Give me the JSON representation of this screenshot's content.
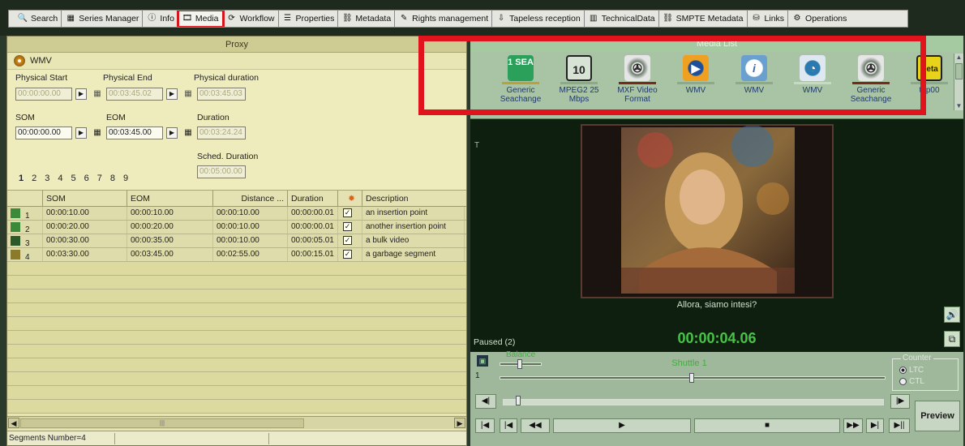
{
  "tabs": [
    {
      "label": "Search",
      "icon": "search-icon",
      "active": false
    },
    {
      "label": "Series Manager",
      "icon": "series-icon",
      "active": false
    },
    {
      "label": "Info",
      "icon": "info-icon",
      "active": false
    },
    {
      "label": "Media",
      "icon": "media-icon",
      "active": true
    },
    {
      "label": "Workflow",
      "icon": "workflow-icon",
      "active": false
    },
    {
      "label": "Properties",
      "icon": "properties-icon",
      "active": false
    },
    {
      "label": "Metadata",
      "icon": "metadata-icon",
      "active": false
    },
    {
      "label": "Rights management",
      "icon": "rights-icon",
      "active": false
    },
    {
      "label": "Tapeless reception",
      "icon": "tapeless-icon",
      "active": false
    },
    {
      "label": "TechnicalData",
      "icon": "technical-icon",
      "active": false
    },
    {
      "label": "SMPTE Metadata",
      "icon": "smpte-icon",
      "active": false
    },
    {
      "label": "Links",
      "icon": "links-icon",
      "active": false
    },
    {
      "label": "Operations",
      "icon": "operations-icon",
      "active": false
    }
  ],
  "proxy": {
    "title": "Proxy",
    "format": "WMV",
    "physical_start_label": "Physical Start",
    "physical_end_label": "Physical End",
    "physical_duration_label": "Physical duration",
    "physical_start": "00:00:00.00",
    "physical_end": "00:03:45.02",
    "physical_duration": "00:03:45.03",
    "som_label": "SOM",
    "eom_label": "EOM",
    "duration_label": "Duration",
    "som": "00:00:00.00",
    "eom": "00:03:45.00",
    "duration": "00:03:24.24",
    "sched_duration_label": "Sched. Duration",
    "sched_duration": "00:05:00.00",
    "pages": [
      "1",
      "2",
      "3",
      "4",
      "5",
      "6",
      "7",
      "8",
      "9"
    ]
  },
  "table": {
    "headers": [
      "SOM",
      "EOM",
      "Distance ...",
      "Duration",
      "",
      "Description"
    ],
    "rows": [
      {
        "n": "1",
        "som": "00:00:10.00",
        "eom": "00:00:10.00",
        "distance": "00:00:10.00",
        "duration": "00:00:00.01",
        "desc": "an insertion point"
      },
      {
        "n": "2",
        "som": "00:00:20.00",
        "eom": "00:00:20.00",
        "distance": "00:00:10.00",
        "duration": "00:00:00.01",
        "desc": "another insertion point"
      },
      {
        "n": "3",
        "som": "00:00:30.00",
        "eom": "00:00:35.00",
        "distance": "00:00:10.00",
        "duration": "00:00:05.01",
        "desc": "a bulk video"
      },
      {
        "n": "4",
        "som": "00:03:30.00",
        "eom": "00:03:45.00",
        "distance": "00:02:55.00",
        "duration": "00:00:15.01",
        "desc": "a garbage segment"
      }
    ]
  },
  "status": "Segments Number=4",
  "media_list": {
    "title": "Media List",
    "items": [
      {
        "label": "Generic Seachange",
        "icon": "sea-icon",
        "text": "1 SEA",
        "bar": "#b9a23a"
      },
      {
        "label": "MPEG2 25 Mbps",
        "icon": "mpeg-icon",
        "text": "10",
        "bar": "#8da88a"
      },
      {
        "label": "MXF Video Format",
        "icon": "film-reel-icon",
        "text": "",
        "bar": "#7a2a1a"
      },
      {
        "label": "WMV",
        "icon": "wmv-play-icon",
        "text": "",
        "bar": "#8da88a"
      },
      {
        "label": "WMV",
        "icon": "wmv-info-icon",
        "text": "",
        "bar": "#8da88a"
      },
      {
        "label": "WMV",
        "icon": "wmv-pie-icon",
        "text": "",
        "bar": "#c8d8c4"
      },
      {
        "label": "Generic Seachange",
        "icon": "film-reel-icon",
        "text": "",
        "bar": "#7a2a1a"
      },
      {
        "label": "tap00",
        "icon": "beta-tape-icon",
        "text": "Beta",
        "bar": "#8da88a"
      }
    ]
  },
  "player": {
    "t_marker": "T",
    "subtitle": "Allora, siamo intesi?",
    "state": "Paused (2)",
    "timecode": "00:00:04.06",
    "balance_label": "Balance",
    "shuttle_label": "Shuttle 1",
    "track": "1",
    "counter_label": "Counter",
    "counter_options": [
      "LTC",
      "CTL"
    ],
    "preview_label": "Preview"
  }
}
